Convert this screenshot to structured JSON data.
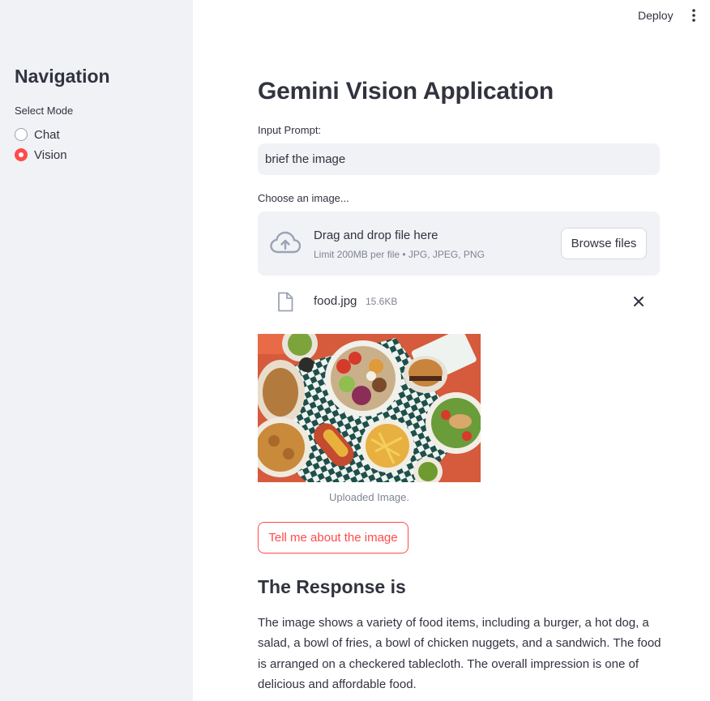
{
  "header": {
    "deploy_label": "Deploy",
    "menu_icon": "kebab-menu-icon"
  },
  "sidebar": {
    "title": "Navigation",
    "mode_label": "Select Mode",
    "options": [
      {
        "label": "Chat",
        "selected": false
      },
      {
        "label": "Vision",
        "selected": true
      }
    ]
  },
  "main": {
    "title": "Gemini Vision Application",
    "prompt_label": "Input Prompt:",
    "prompt_value": "brief the image",
    "image_label": "Choose an image...",
    "dropzone": {
      "icon": "cloud-upload-icon",
      "main_text": "Drag and drop file here",
      "sub_text": "Limit 200MB per file • JPG, JPEG, PNG",
      "browse_label": "Browse files"
    },
    "uploaded_file": {
      "icon": "file-icon",
      "name": "food.jpg",
      "size": "15.6KB",
      "remove_icon": "close-icon"
    },
    "image_caption": "Uploaded Image.",
    "submit_label": "Tell me about the image",
    "response_title": "The Response is",
    "response_text": "The image shows a variety of food items, including a burger, a hot dog, a salad, a bowl of fries, a bowl of chicken nuggets, and a sandwich. The food is arranged on a checkered tablecloth. The overall impression is one of delicious and affordable food."
  },
  "colors": {
    "accent": "#ff4b4b",
    "sidebar_bg": "#f0f2f6",
    "text": "#31333f",
    "muted": "#808495"
  }
}
